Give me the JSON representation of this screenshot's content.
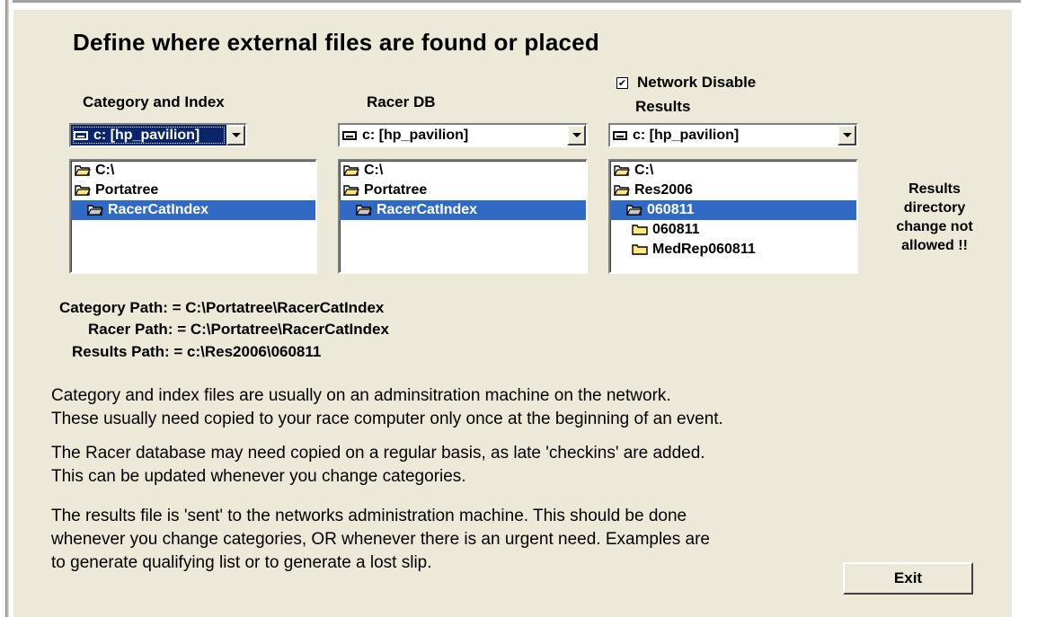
{
  "title": "Define where external files are found or placed",
  "network_disable": {
    "label": "Network Disable",
    "checked": true,
    "mark": "✔"
  },
  "columns": [
    {
      "label": "Category and Index",
      "drive": "c: [hp_pavilion]",
      "folders": [
        "C:\\",
        "Portatree",
        "RacerCatIndex"
      ]
    },
    {
      "label": "Racer DB",
      "drive": "c: [hp_pavilion]",
      "folders": [
        "C:\\",
        "Portatree",
        "RacerCatIndex"
      ]
    },
    {
      "label": "Results",
      "drive": "c: [hp_pavilion]",
      "folders": [
        "C:\\",
        "Res2006",
        "060811",
        "060811",
        "MedRep060811"
      ]
    }
  ],
  "results_note": [
    "Results",
    "directory",
    "change not",
    "allowed !!"
  ],
  "paths": {
    "category": "Category Path: = C:\\Portatree\\RacerCatIndex",
    "racer": "Racer Path: = C:\\Portatree\\RacerCatIndex",
    "results": "Results Path: = c:\\Res2006\\060811"
  },
  "paragraphs": {
    "p1": [
      "Category and index files are usually on an adminsitration machine on the network.",
      "These usually need copied to your race computer only once at the beginning of an event."
    ],
    "p2": [
      "The Racer database may need copied on a regular basis, as late 'checkins' are added.",
      "This can be updated whenever you change categories."
    ],
    "p3": [
      "The results file is 'sent' to the networks administration machine.  This should be done",
      "whenever you change categories, OR whenever there is an urgent need.  Examples are",
      "to generate qualifying list or to generate a lost slip."
    ]
  },
  "exit_label": "Exit",
  "colors": {
    "panel": "#ece9d8",
    "selection": "#316ac5",
    "focus": "#0a246a"
  }
}
